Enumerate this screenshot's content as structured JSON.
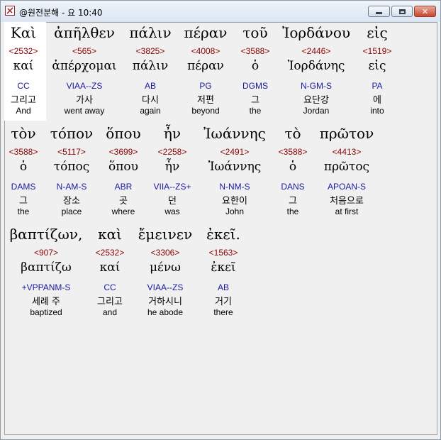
{
  "window": {
    "title": "@원전분해 - 요 10:40",
    "controls": [
      "minimize",
      "maximize",
      "close"
    ],
    "close_symbol": "✕"
  },
  "rows": [
    {
      "words": [
        {
          "greek": "Καὶ",
          "strong": "<2532>",
          "lemma": "καί",
          "morph": "CC",
          "korean": "그리고",
          "english": "And"
        },
        {
          "greek": "ἀπῆλθεν",
          "strong": "<565>",
          "lemma": "ἀπέρχομαι",
          "morph": "VIAA--ZS",
          "korean": "가사",
          "english": "went away"
        },
        {
          "greek": "πάλιν",
          "strong": "<3825>",
          "lemma": "πάλιν",
          "morph": "AB",
          "korean": "다시",
          "english": "again"
        },
        {
          "greek": "πέραν",
          "strong": "<4008>",
          "lemma": "πέραν",
          "morph": "PG",
          "korean": "저편",
          "english": "beyond"
        },
        {
          "greek": "τοῦ",
          "strong": "<3588>",
          "lemma": "ὁ",
          "morph": "DGMS",
          "korean": "그",
          "english": "the"
        },
        {
          "greek": "Ἰορδάνου",
          "strong": "<2446>",
          "lemma": "Ἰορδάνης",
          "morph": "N-GM-S",
          "korean": "요단강",
          "english": "Jordan"
        },
        {
          "greek": "εἰς",
          "strong": "<1519>",
          "lemma": "εἰς",
          "morph": "PA",
          "korean": "에",
          "english": "into"
        }
      ]
    },
    {
      "words": [
        {
          "greek": "τὸν",
          "strong": "<3588>",
          "lemma": "ὁ",
          "morph": "DAMS",
          "korean": "그",
          "english": "the"
        },
        {
          "greek": "τόπον",
          "strong": "<5117>",
          "lemma": "τόπος",
          "morph": "N-AM-S",
          "korean": "장소",
          "english": "place"
        },
        {
          "greek": "ὅπου",
          "strong": "<3699>",
          "lemma": "ὅπου",
          "morph": "ABR",
          "korean": "곳",
          "english": "where"
        },
        {
          "greek": "ἦν",
          "strong": "<2258>",
          "lemma": "ἦν",
          "morph": "VIIA--ZS+",
          "korean": "던",
          "english": "was"
        },
        {
          "greek": "Ἰωάννης",
          "strong": "<2491>",
          "lemma": "Ἰωάννης",
          "morph": "N-NM-S",
          "korean": "요한이",
          "english": "John"
        },
        {
          "greek": "τὸ",
          "strong": "<3588>",
          "lemma": "ὁ",
          "morph": "DANS",
          "korean": "그",
          "english": "the"
        },
        {
          "greek": "πρῶτον",
          "strong": "<4413>",
          "lemma": "πρῶτος",
          "morph": "APOAN-S",
          "korean": "처음으로",
          "english": "at first"
        }
      ]
    },
    {
      "words": [
        {
          "greek": "βαπτίζων,",
          "strong": "<907>",
          "lemma": "βαπτίζω",
          "morph": "+VPPANM-S",
          "korean": "세례 주",
          "english": "baptized"
        },
        {
          "greek": "καὶ",
          "strong": "<2532>",
          "lemma": "καί",
          "morph": "CC",
          "korean": "그리고",
          "english": "and"
        },
        {
          "greek": "ἔμεινεν",
          "strong": "<3306>",
          "lemma": "μένω",
          "morph": "VIAA--ZS",
          "korean": "거하시니",
          "english": "he abode"
        },
        {
          "greek": "ἐκεῖ.",
          "strong": "<1563>",
          "lemma": "ἐκεῖ",
          "morph": "AB",
          "korean": "거기",
          "english": "there"
        }
      ]
    }
  ]
}
